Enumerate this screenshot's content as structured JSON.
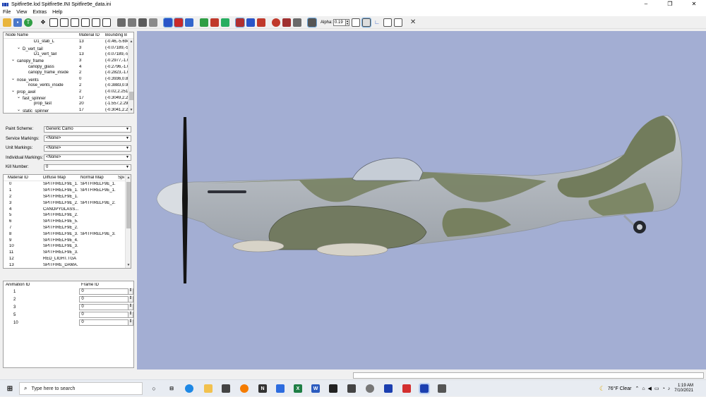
{
  "window": {
    "title": "Spitfire9e.lod  Spitfire9e.INI  Spitfire9e_data.ini",
    "controls": [
      "–",
      "❐",
      "✕"
    ]
  },
  "menu": [
    "File",
    "View",
    "Extras",
    "Help"
  ],
  "toolbar": {
    "alpha_label": "Alpha",
    "alpha_value": "0.19"
  },
  "node_tree": {
    "columns": [
      "Node Name",
      "Material ID",
      "Bounding B"
    ],
    "rows": [
      {
        "name": "D1_stab_L",
        "indent": 4,
        "exp": "",
        "mat": "13",
        "bb": "(-0.46,-5.694"
      },
      {
        "name": "D_vert_tail",
        "indent": 2,
        "exp": "⌄",
        "mat": "3",
        "bb": "(-0.07189,-5."
      },
      {
        "name": "D1_vert_tail",
        "indent": 4,
        "exp": "",
        "mat": "13",
        "bb": "(-0.07189,-5."
      },
      {
        "name": "canopy_frame",
        "indent": 1,
        "exp": "⌄",
        "mat": "3",
        "bb": "(-0.2977,-1.6"
      },
      {
        "name": "canopy_glass",
        "indent": 3,
        "exp": "",
        "mat": "4",
        "bb": "(-0.2796,-1.6"
      },
      {
        "name": "canopy_frame_inside",
        "indent": 3,
        "exp": "",
        "mat": "2",
        "bb": "(-0.2823,-1.6"
      },
      {
        "name": "nose_vents",
        "indent": 1,
        "exp": "⌄",
        "mat": "0",
        "bb": "(-0.3936,0.8("
      },
      {
        "name": "nose_vents_inside",
        "indent": 3,
        "exp": "",
        "mat": "2",
        "bb": "(-0.3883,0.9("
      },
      {
        "name": "prop_axel",
        "indent": 1,
        "exp": "⌄",
        "mat": "2",
        "bb": "(-0.02,2.251,"
      },
      {
        "name": "fast_spinner",
        "indent": 2,
        "exp": "⌄",
        "mat": "17",
        "bb": "(-0.3049,2.27"
      },
      {
        "name": "prop_fast",
        "indent": 4,
        "exp": "",
        "mat": "20",
        "bb": "(-1.557,2.297"
      },
      {
        "name": "static_spinner",
        "indent": 2,
        "exp": "⌄",
        "mat": "17",
        "bb": "(-0.3041,2.28"
      }
    ]
  },
  "fields": [
    {
      "label": "Paint Scheme:",
      "value": "Generic Camo"
    },
    {
      "label": "Service Markings:",
      "value": "<None>"
    },
    {
      "label": "Unit Markings:",
      "value": "<None>"
    },
    {
      "label": "Individual Markings:",
      "value": "<None>"
    },
    {
      "label": "Kill Number:",
      "value": "0"
    }
  ],
  "materials": {
    "columns": [
      "Material ID",
      "Diffuse Map",
      "Normal Map",
      "Spe"
    ],
    "rows": [
      [
        "0",
        "SPITFIRELF9E_1....",
        "SPITFIRELF9E_1...."
      ],
      [
        "1",
        "SPITFIRELF9E_1....",
        "SPITFIRELF9E_1...."
      ],
      [
        "2",
        "SPITFIRELF9E_1....",
        ""
      ],
      [
        "3",
        "SPITFIRELF9E_2....",
        "SPITFIRELF9E_2...."
      ],
      [
        "4",
        "CANOPYGLASS....",
        ""
      ],
      [
        "5",
        "SPITFIRELF9E_2....",
        ""
      ],
      [
        "6",
        "SPITFIRELF9E_5....",
        ""
      ],
      [
        "7",
        "SPITFIRELF9E_2....",
        ""
      ],
      [
        "8",
        "SPITFIRELF9E_3....",
        "SPITFIRELF9E_3...."
      ],
      [
        "9",
        "SPITFIRELF9E_4....",
        ""
      ],
      [
        "10",
        "SPITFIRELF9E_3....",
        ""
      ],
      [
        "11",
        "SPITFIRELF9E_3....",
        ""
      ],
      [
        "12",
        "RED_LIGHT.TGA",
        ""
      ],
      [
        "13",
        "SPITFIRE_DAMA....",
        ""
      ]
    ]
  },
  "animation": {
    "columns": [
      "Animation ID",
      "Frame ID"
    ],
    "rows": [
      {
        "id": "1",
        "frame": "0"
      },
      {
        "id": "2",
        "frame": "0"
      },
      {
        "id": "3",
        "frame": "0"
      },
      {
        "id": "5",
        "frame": "0"
      },
      {
        "id": "10",
        "frame": "0"
      }
    ]
  },
  "viewport": {
    "background": "#a3aed3"
  },
  "taskbar": {
    "search_placeholder": "Type here to search",
    "weather": "76°F  Clear",
    "time": "1:19 AM",
    "date": "7/10/2021"
  }
}
